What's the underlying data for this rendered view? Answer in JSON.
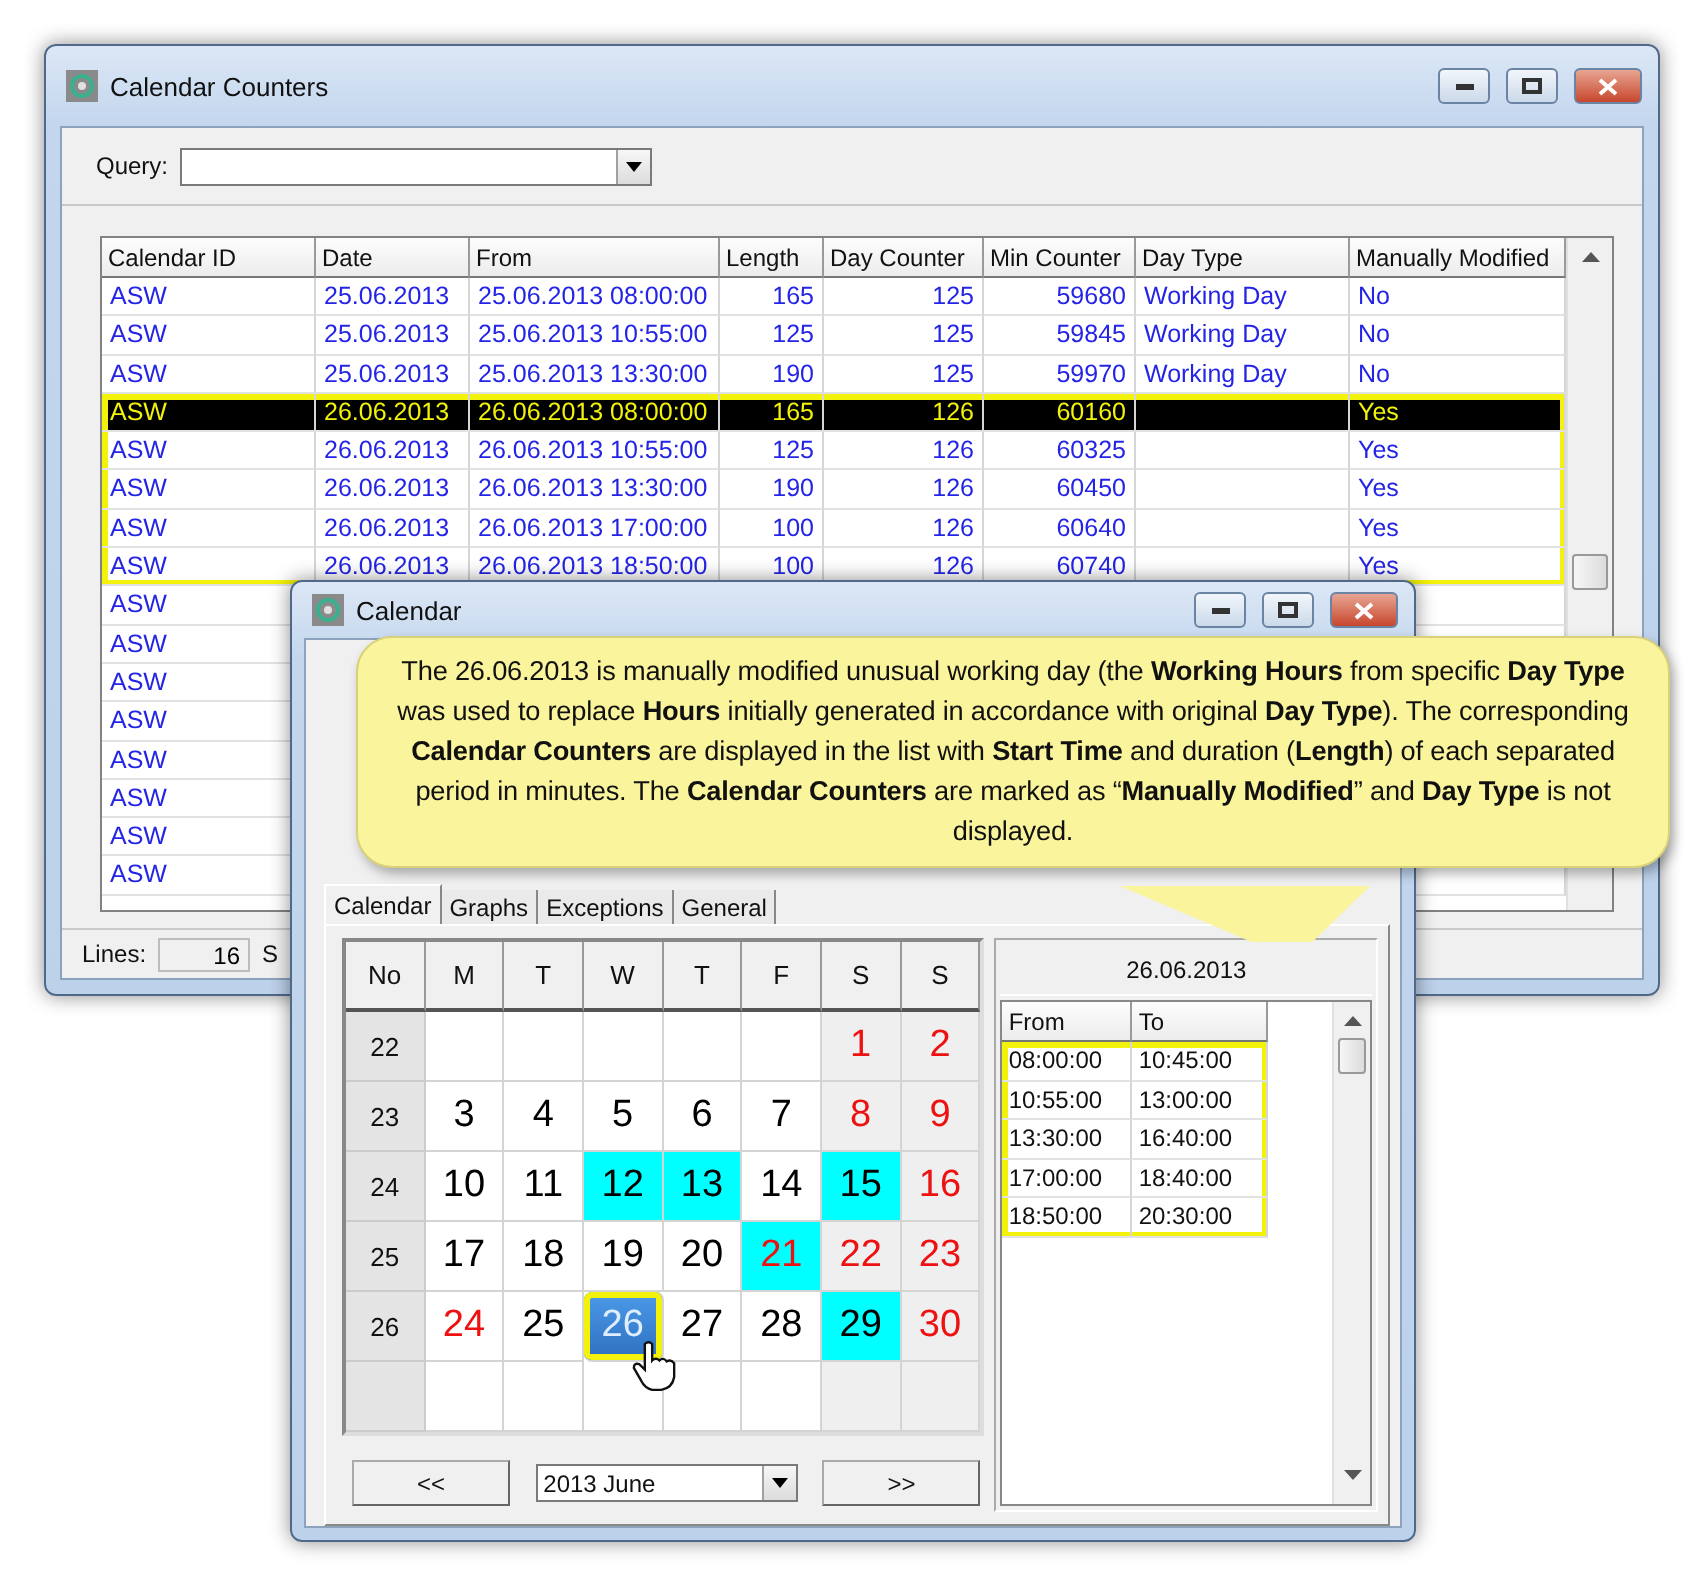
{
  "counters_window": {
    "title": "Calendar Counters",
    "query_label": "Query:",
    "table": {
      "columns": [
        "Calendar ID",
        "Date",
        "From",
        "Length",
        "Day Counter",
        "Min Counter",
        "Day Type",
        "Manually Modified"
      ],
      "rows": [
        {
          "calendar_id": "ASW",
          "date": "25.06.2013",
          "from": "25.06.2013 08:00:00",
          "length": "165",
          "day_counter": "125",
          "min_counter": "59680",
          "day_type": "Working Day",
          "manually_modified": "No",
          "selected": false,
          "outlined": false
        },
        {
          "calendar_id": "ASW",
          "date": "25.06.2013",
          "from": "25.06.2013 10:55:00",
          "length": "125",
          "day_counter": "125",
          "min_counter": "59845",
          "day_type": "Working Day",
          "manually_modified": "No",
          "selected": false,
          "outlined": false
        },
        {
          "calendar_id": "ASW",
          "date": "25.06.2013",
          "from": "25.06.2013 13:30:00",
          "length": "190",
          "day_counter": "125",
          "min_counter": "59970",
          "day_type": "Working Day",
          "manually_modified": "No",
          "selected": false,
          "outlined": false
        },
        {
          "calendar_id": "ASW",
          "date": "26.06.2013",
          "from": "26.06.2013 08:00:00",
          "length": "165",
          "day_counter": "126",
          "min_counter": "60160",
          "manually_modified": "Yes",
          "selected": true,
          "outlined": true
        },
        {
          "calendar_id": "ASW",
          "date": "26.06.2013",
          "from": "26.06.2013 10:55:00",
          "length": "125",
          "day_counter": "126",
          "min_counter": "60325",
          "manually_modified": "Yes",
          "selected": false,
          "outlined": true
        },
        {
          "calendar_id": "ASW",
          "date": "26.06.2013",
          "from": "26.06.2013 13:30:00",
          "length": "190",
          "day_counter": "126",
          "min_counter": "60450",
          "manually_modified": "Yes",
          "selected": false,
          "outlined": true
        },
        {
          "calendar_id": "ASW",
          "date": "26.06.2013",
          "from": "26.06.2013 17:00:00",
          "length": "100",
          "day_counter": "126",
          "min_counter": "60640",
          "manually_modified": "Yes",
          "selected": false,
          "outlined": true
        },
        {
          "calendar_id": "ASW",
          "date": "26.06.2013",
          "from": "26.06.2013 18:50:00",
          "length": "100",
          "day_counter": "126",
          "min_counter": "60740",
          "manually_modified": "Yes",
          "selected": false,
          "outlined": true
        },
        {
          "calendar_id": "ASW",
          "selected": false,
          "outlined": false
        },
        {
          "calendar_id": "ASW",
          "selected": false,
          "outlined": false
        },
        {
          "calendar_id": "ASW",
          "selected": false,
          "outlined": false
        },
        {
          "calendar_id": "ASW",
          "selected": false,
          "outlined": false
        },
        {
          "calendar_id": "ASW",
          "selected": false,
          "outlined": false
        },
        {
          "calendar_id": "ASW",
          "selected": false,
          "outlined": false
        },
        {
          "calendar_id": "ASW",
          "selected": false,
          "outlined": false
        },
        {
          "calendar_id": "ASW",
          "selected": false,
          "outlined": false
        }
      ]
    },
    "status": {
      "lines_label": "Lines:",
      "lines_value": "16",
      "next_label": "S"
    }
  },
  "calendar_window": {
    "title": "Calendar",
    "callout": "The 26.06.2013 is manually modified unusual working day (the **Working Hours** from specific **Day Type** was used to replace **Hours** initially generated in accordance with original **Day Type**). The corresponding **Calendar Counters** are displayed in the list with **Start Time** and duration (**Length**) of each separated period in minutes. The **Calendar Counters** are marked as “**Manually Modified**” and **Day Type** is not displayed.",
    "tabs": [
      {
        "label": "Calendar",
        "selected": true
      },
      {
        "label": "Graphs",
        "selected": false
      },
      {
        "label": "Exceptions",
        "selected": false
      },
      {
        "label": "General",
        "selected": false
      }
    ],
    "grid": {
      "headers": [
        "No",
        "M",
        "T",
        "W",
        "T",
        "F",
        "S",
        "S"
      ],
      "weeks": [
        {
          "no": "22",
          "days": [
            {
              "kind": "empty"
            },
            {
              "kind": "empty"
            },
            {
              "kind": "empty"
            },
            {
              "kind": "empty"
            },
            {
              "kind": "empty"
            },
            {
              "kind": "day",
              "day": "1",
              "red": true,
              "marked": false,
              "selected": false
            },
            {
              "kind": "day",
              "day": "2",
              "red": true,
              "marked": false,
              "selected": false
            }
          ]
        },
        {
          "no": "23",
          "days": [
            {
              "kind": "day",
              "day": "3",
              "red": false,
              "marked": false,
              "selected": false
            },
            {
              "kind": "day",
              "day": "4",
              "red": false,
              "marked": false,
              "selected": false
            },
            {
              "kind": "day",
              "day": "5",
              "red": false,
              "marked": false,
              "selected": false
            },
            {
              "kind": "day",
              "day": "6",
              "red": false,
              "marked": false,
              "selected": false
            },
            {
              "kind": "day",
              "day": "7",
              "red": false,
              "marked": false,
              "selected": false
            },
            {
              "kind": "day",
              "day": "8",
              "red": true,
              "marked": false,
              "selected": false
            },
            {
              "kind": "day",
              "day": "9",
              "red": true,
              "marked": false,
              "selected": false
            }
          ]
        },
        {
          "no": "24",
          "days": [
            {
              "kind": "day",
              "day": "10",
              "red": false,
              "marked": false,
              "selected": false
            },
            {
              "kind": "day",
              "day": "11",
              "red": false,
              "marked": false,
              "selected": false
            },
            {
              "kind": "day",
              "day": "12",
              "red": false,
              "marked": true,
              "selected": false
            },
            {
              "kind": "day",
              "day": "13",
              "red": false,
              "marked": true,
              "selected": false
            },
            {
              "kind": "day",
              "day": "14",
              "red": false,
              "marked": false,
              "selected": false
            },
            {
              "kind": "day",
              "day": "15",
              "red": false,
              "marked": true,
              "selected": false
            },
            {
              "kind": "day",
              "day": "16",
              "red": true,
              "marked": false,
              "selected": false
            }
          ]
        },
        {
          "no": "25",
          "days": [
            {
              "kind": "day",
              "day": "17",
              "red": false,
              "marked": false,
              "selected": false
            },
            {
              "kind": "day",
              "day": "18",
              "red": false,
              "marked": false,
              "selected": false
            },
            {
              "kind": "day",
              "day": "19",
              "red": false,
              "marked": false,
              "selected": false
            },
            {
              "kind": "day",
              "day": "20",
              "red": false,
              "marked": false,
              "selected": false
            },
            {
              "kind": "day",
              "day": "21",
              "red": true,
              "marked": true,
              "selected": false
            },
            {
              "kind": "day",
              "day": "22",
              "red": true,
              "marked": false,
              "selected": false
            },
            {
              "kind": "day",
              "day": "23",
              "red": true,
              "marked": false,
              "selected": false
            }
          ]
        },
        {
          "no": "26",
          "days": [
            {
              "kind": "day",
              "day": "24",
              "red": true,
              "marked": false,
              "selected": false
            },
            {
              "kind": "day",
              "day": "25",
              "red": false,
              "marked": false,
              "selected": false
            },
            {
              "kind": "day",
              "day": "26",
              "red": false,
              "marked": false,
              "selected": true
            },
            {
              "kind": "day",
              "day": "27",
              "red": false,
              "marked": false,
              "selected": false
            },
            {
              "kind": "day",
              "day": "28",
              "red": false,
              "marked": false,
              "selected": false
            },
            {
              "kind": "day",
              "day": "29",
              "red": false,
              "marked": true,
              "selected": false
            },
            {
              "kind": "day",
              "day": "30",
              "red": true,
              "marked": false,
              "selected": false
            }
          ]
        },
        {
          "days": [
            {
              "kind": "empty"
            },
            {
              "kind": "empty"
            },
            {
              "kind": "empty"
            },
            {
              "kind": "empty"
            },
            {
              "kind": "empty"
            },
            {
              "kind": "empty"
            },
            {
              "kind": "empty"
            }
          ]
        }
      ]
    },
    "prev_button": "<<",
    "month_select": "2013 June",
    "next_button": ">>",
    "day_panel": {
      "date": "26.06.2013",
      "columns": [
        "From",
        "To"
      ],
      "rows": [
        {
          "from": "08:00:00",
          "to": "10:45:00",
          "outlined": true
        },
        {
          "from": "10:55:00",
          "to": "13:00:00",
          "outlined": true
        },
        {
          "from": "13:30:00",
          "to": "16:40:00",
          "outlined": true
        },
        {
          "from": "17:00:00",
          "to": "18:40:00",
          "outlined": true
        },
        {
          "from": "18:50:00",
          "to": "20:30:00",
          "outlined": true
        }
      ]
    }
  }
}
